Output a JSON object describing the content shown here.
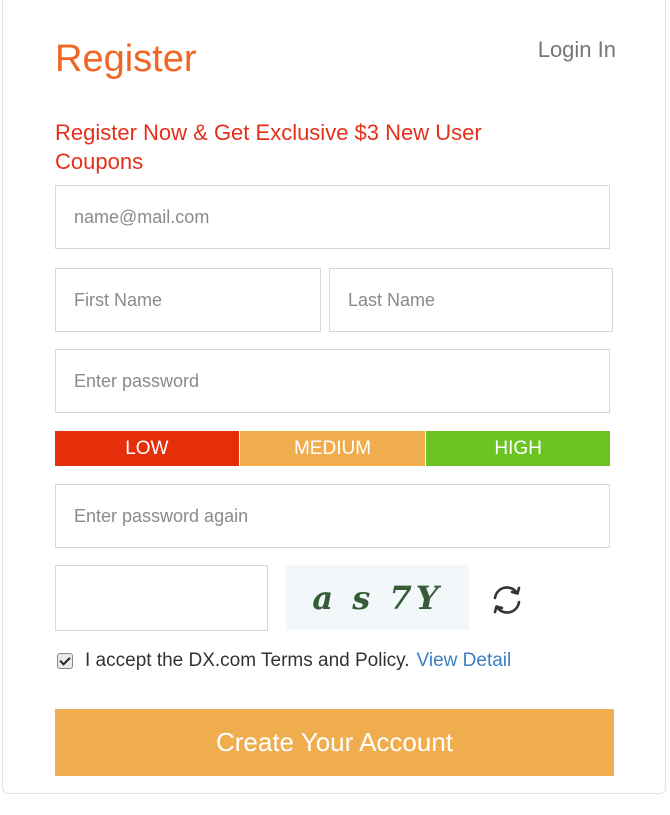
{
  "header": {
    "title": "Register",
    "login_link": "Login In"
  },
  "promo_text": "Register Now & Get Exclusive $3 New User Coupons",
  "form": {
    "email_placeholder": "name@mail.com",
    "first_name_placeholder": "First Name",
    "last_name_placeholder": "Last Name",
    "password_placeholder": "Enter password",
    "password_again_placeholder": "Enter password again",
    "captcha_value": ""
  },
  "strength": {
    "low": "LOW",
    "medium": "MEDIUM",
    "high": "HIGH"
  },
  "captcha": {
    "text": "a s 7Y"
  },
  "terms": {
    "checked": true,
    "text": "I accept the DX.com Terms and Policy.",
    "link": "View Detail"
  },
  "submit_label": "Create Your Account",
  "colors": {
    "brand_orange": "#f26522",
    "promo_red": "#e4301b",
    "low": "#e42f0a",
    "medium": "#f0ad4e",
    "high": "#6bc424",
    "button": "#f0ad4e",
    "link": "#3a7fc4"
  },
  "icons": {
    "refresh": "refresh-icon"
  }
}
